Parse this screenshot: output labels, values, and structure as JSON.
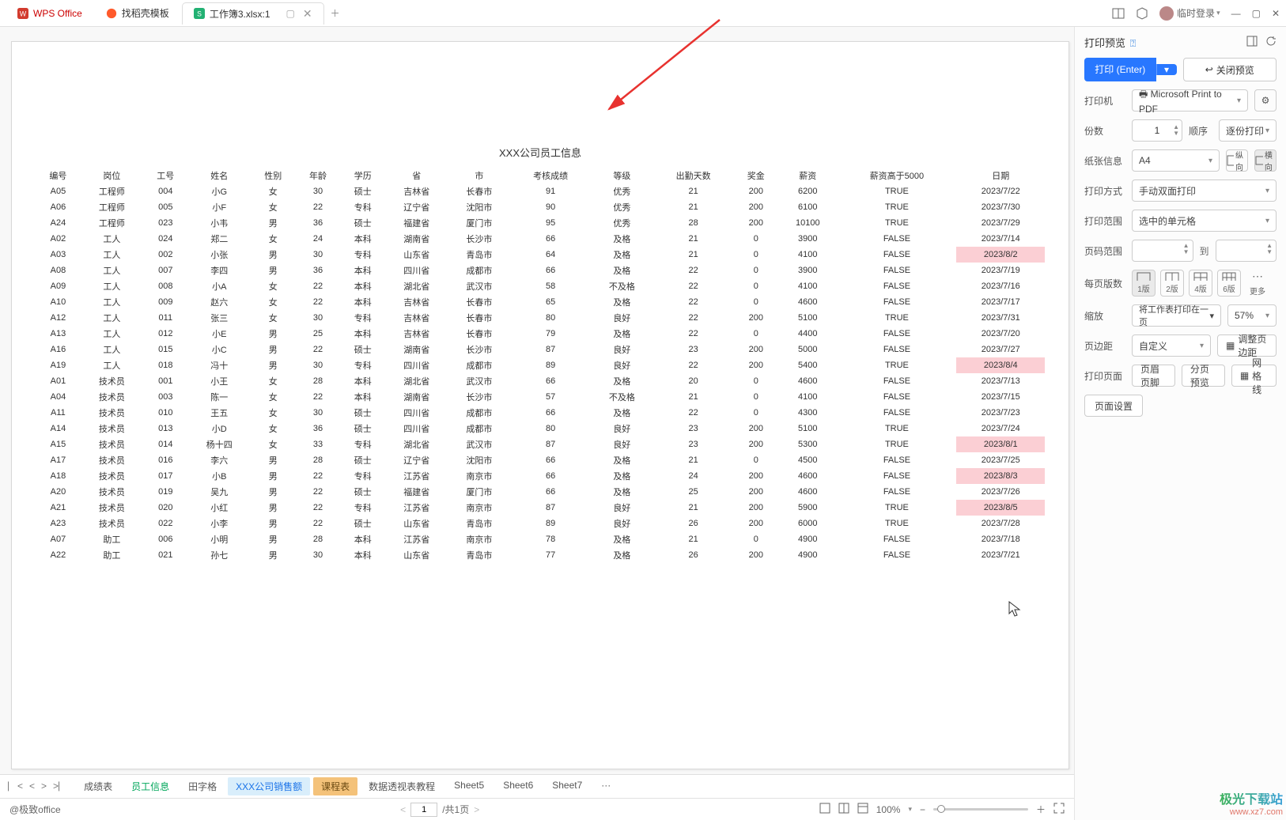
{
  "titlebar": {
    "home": "WPS Office",
    "template": "找稻壳模板",
    "active_tab": "工作簿3.xlsx:1",
    "login": "临时登录"
  },
  "arrow_color": "#e8322f",
  "preview": {
    "title": "XXX公司员工信息",
    "headers": [
      "编号",
      "岗位",
      "工号",
      "姓名",
      "性别",
      "年龄",
      "学历",
      "省",
      "市",
      "考核成绩",
      "等级",
      "出勤天数",
      "奖金",
      "薪资",
      "薪资高于5000",
      "日期"
    ],
    "rows": [
      {
        "c": [
          "A05",
          "工程师",
          "004",
          "小G",
          "女",
          "30",
          "硕士",
          "吉林省",
          "长春市",
          "91",
          "优秀",
          "21",
          "200",
          "6200",
          "TRUE",
          "2023/7/22"
        ],
        "hl": false
      },
      {
        "c": [
          "A06",
          "工程师",
          "005",
          "小F",
          "女",
          "22",
          "专科",
          "辽宁省",
          "沈阳市",
          "90",
          "优秀",
          "21",
          "200",
          "6100",
          "TRUE",
          "2023/7/30"
        ],
        "hl": false
      },
      {
        "c": [
          "A24",
          "工程师",
          "023",
          "小韦",
          "男",
          "36",
          "硕士",
          "福建省",
          "厦门市",
          "95",
          "优秀",
          "28",
          "200",
          "10100",
          "TRUE",
          "2023/7/29"
        ],
        "hl": false
      },
      {
        "c": [
          "A02",
          "工人",
          "024",
          "郑二",
          "女",
          "24",
          "本科",
          "湖南省",
          "长沙市",
          "66",
          "及格",
          "21",
          "0",
          "3900",
          "FALSE",
          "2023/7/14"
        ],
        "hl": false
      },
      {
        "c": [
          "A03",
          "工人",
          "002",
          "小张",
          "男",
          "30",
          "专科",
          "山东省",
          "青岛市",
          "64",
          "及格",
          "21",
          "0",
          "4100",
          "FALSE",
          "2023/8/2"
        ],
        "hl": true
      },
      {
        "c": [
          "A08",
          "工人",
          "007",
          "李四",
          "男",
          "36",
          "本科",
          "四川省",
          "成都市",
          "66",
          "及格",
          "22",
          "0",
          "3900",
          "FALSE",
          "2023/7/19"
        ],
        "hl": false
      },
      {
        "c": [
          "A09",
          "工人",
          "008",
          "小A",
          "女",
          "22",
          "本科",
          "湖北省",
          "武汉市",
          "58",
          "不及格",
          "22",
          "0",
          "4100",
          "FALSE",
          "2023/7/16"
        ],
        "hl": false
      },
      {
        "c": [
          "A10",
          "工人",
          "009",
          "赵六",
          "女",
          "22",
          "本科",
          "吉林省",
          "长春市",
          "65",
          "及格",
          "22",
          "0",
          "4600",
          "FALSE",
          "2023/7/17"
        ],
        "hl": false
      },
      {
        "c": [
          "A12",
          "工人",
          "011",
          "张三",
          "女",
          "30",
          "专科",
          "吉林省",
          "长春市",
          "80",
          "良好",
          "22",
          "200",
          "5100",
          "TRUE",
          "2023/7/31"
        ],
        "hl": false
      },
      {
        "c": [
          "A13",
          "工人",
          "012",
          "小E",
          "男",
          "25",
          "本科",
          "吉林省",
          "长春市",
          "79",
          "及格",
          "22",
          "0",
          "4400",
          "FALSE",
          "2023/7/20"
        ],
        "hl": false
      },
      {
        "c": [
          "A16",
          "工人",
          "015",
          "小C",
          "男",
          "22",
          "硕士",
          "湖南省",
          "长沙市",
          "87",
          "良好",
          "23",
          "200",
          "5000",
          "FALSE",
          "2023/7/27"
        ],
        "hl": false
      },
      {
        "c": [
          "A19",
          "工人",
          "018",
          "冯十",
          "男",
          "30",
          "专科",
          "四川省",
          "成都市",
          "89",
          "良好",
          "22",
          "200",
          "5400",
          "TRUE",
          "2023/8/4"
        ],
        "hl": true
      },
      {
        "c": [
          "A01",
          "技术员",
          "001",
          "小王",
          "女",
          "28",
          "本科",
          "湖北省",
          "武汉市",
          "66",
          "及格",
          "20",
          "0",
          "4600",
          "FALSE",
          "2023/7/13"
        ],
        "hl": false
      },
      {
        "c": [
          "A04",
          "技术员",
          "003",
          "陈一",
          "女",
          "22",
          "本科",
          "湖南省",
          "长沙市",
          "57",
          "不及格",
          "21",
          "0",
          "4100",
          "FALSE",
          "2023/7/15"
        ],
        "hl": false
      },
      {
        "c": [
          "A11",
          "技术员",
          "010",
          "王五",
          "女",
          "30",
          "硕士",
          "四川省",
          "成都市",
          "66",
          "及格",
          "22",
          "0",
          "4300",
          "FALSE",
          "2023/7/23"
        ],
        "hl": false
      },
      {
        "c": [
          "A14",
          "技术员",
          "013",
          "小D",
          "女",
          "36",
          "硕士",
          "四川省",
          "成都市",
          "80",
          "良好",
          "23",
          "200",
          "5100",
          "TRUE",
          "2023/7/24"
        ],
        "hl": false
      },
      {
        "c": [
          "A15",
          "技术员",
          "014",
          "杨十四",
          "女",
          "33",
          "专科",
          "湖北省",
          "武汉市",
          "87",
          "良好",
          "23",
          "200",
          "5300",
          "TRUE",
          "2023/8/1"
        ],
        "hl": true
      },
      {
        "c": [
          "A17",
          "技术员",
          "016",
          "李六",
          "男",
          "28",
          "硕士",
          "辽宁省",
          "沈阳市",
          "66",
          "及格",
          "21",
          "0",
          "4500",
          "FALSE",
          "2023/7/25"
        ],
        "hl": false
      },
      {
        "c": [
          "A18",
          "技术员",
          "017",
          "小B",
          "男",
          "22",
          "专科",
          "江苏省",
          "南京市",
          "66",
          "及格",
          "24",
          "200",
          "4600",
          "FALSE",
          "2023/8/3"
        ],
        "hl": true
      },
      {
        "c": [
          "A20",
          "技术员",
          "019",
          "吴九",
          "男",
          "22",
          "硕士",
          "福建省",
          "厦门市",
          "66",
          "及格",
          "25",
          "200",
          "4600",
          "FALSE",
          "2023/7/26"
        ],
        "hl": false
      },
      {
        "c": [
          "A21",
          "技术员",
          "020",
          "小红",
          "男",
          "22",
          "专科",
          "江苏省",
          "南京市",
          "87",
          "良好",
          "21",
          "200",
          "5900",
          "TRUE",
          "2023/8/5"
        ],
        "hl": true
      },
      {
        "c": [
          "A23",
          "技术员",
          "022",
          "小李",
          "男",
          "22",
          "硕士",
          "山东省",
          "青岛市",
          "89",
          "良好",
          "26",
          "200",
          "6000",
          "TRUE",
          "2023/7/28"
        ],
        "hl": false
      },
      {
        "c": [
          "A07",
          "助工",
          "006",
          "小明",
          "男",
          "28",
          "本科",
          "江苏省",
          "南京市",
          "78",
          "及格",
          "21",
          "0",
          "4900",
          "FALSE",
          "2023/7/18"
        ],
        "hl": false
      },
      {
        "c": [
          "A22",
          "助工",
          "021",
          "孙七",
          "男",
          "30",
          "本科",
          "山东省",
          "青岛市",
          "77",
          "及格",
          "26",
          "200",
          "4900",
          "FALSE",
          "2023/7/21"
        ],
        "hl": false
      }
    ]
  },
  "sheets": [
    "成绩表",
    "员工信息",
    "田字格",
    "XXX公司销售额",
    "课程表",
    "数据透视表教程",
    "Sheet5",
    "Sheet6",
    "Sheet7",
    "···"
  ],
  "active_sheet_index": 3,
  "status": {
    "credit": "@极致office",
    "page": "1",
    "total": "/共1页",
    "zoom": "100%"
  },
  "panel": {
    "title": "打印预览",
    "print": "打印 (Enter)",
    "close_preview": "关闭预览",
    "printer_lbl": "打印机",
    "printer_val": "Microsoft Print to PDF",
    "copies_lbl": "份数",
    "copies_val": "1",
    "order_lbl": "顺序",
    "order_val": "逐份打印",
    "paper_lbl": "纸张信息",
    "paper_val": "A4",
    "portrait": "纵向",
    "landscape": "横向",
    "duplex_lbl": "打印方式",
    "duplex_val": "手动双面打印",
    "range_lbl": "打印范围",
    "range_val": "选中的单元格",
    "page_range_lbl": "页码范围",
    "to": "到",
    "per_page_lbl": "每页版数",
    "layouts": [
      "1版",
      "2版",
      "4版",
      "6版",
      "更多"
    ],
    "scale_lbl": "缩放",
    "scale_val": "将工作表打印在一页",
    "scale_pct": "57%",
    "margin_lbl": "页边距",
    "margin_val": "自定义",
    "adjust_margin": "调整页边距",
    "print_page_lbl": "打印页面",
    "hf": "页眉页脚",
    "split": "分页预览",
    "grid": "网格线",
    "page_setup": "页面设置"
  },
  "watermark": {
    "l1": "极光下载站",
    "l2": "www.xz7.com"
  }
}
